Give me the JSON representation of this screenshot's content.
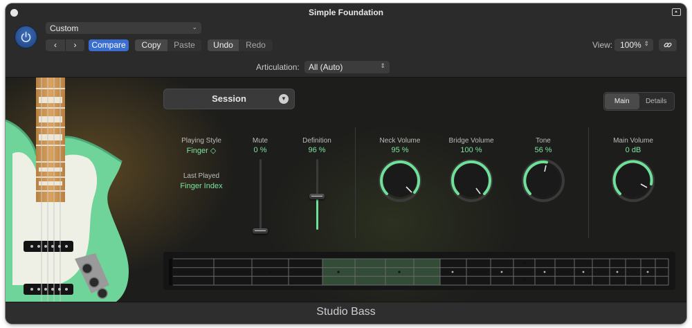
{
  "window": {
    "title": "Simple Foundation"
  },
  "header": {
    "preset": "Custom",
    "back_icon": "‹",
    "forward_icon": "›",
    "compare": "Compare",
    "copy": "Copy",
    "paste": "Paste",
    "undo": "Undo",
    "redo": "Redo",
    "view_label": "View:",
    "zoom": "100%",
    "articulation_label": "Articulation:",
    "articulation_value": "All (Auto)"
  },
  "session": {
    "label": "Session"
  },
  "tabs": [
    {
      "label": "Main",
      "active": true
    },
    {
      "label": "Details",
      "active": false
    }
  ],
  "controls": {
    "playing_style": {
      "label": "Playing Style",
      "value": "Finger ◇"
    },
    "last_played": {
      "label": "Last Played",
      "value": "Finger Index"
    },
    "mute": {
      "label": "Mute",
      "value": "0 %",
      "level": 0
    },
    "definition": {
      "label": "Definition",
      "value": "96 %",
      "level": 0.96
    },
    "neck_volume": {
      "label": "Neck Volume",
      "value": "95 %",
      "level": 0.95
    },
    "bridge_volume": {
      "label": "Bridge Volume",
      "value": "100 %",
      "level": 1.0
    },
    "tone": {
      "label": "Tone",
      "value": "56 %",
      "level": 0.56
    },
    "main_volume": {
      "label": "Main Volume",
      "value": "0 dB",
      "level": 0.8
    }
  },
  "colors": {
    "accent_green": "#6fe09a",
    "compare_blue": "#3a6fd1",
    "power_blue": "#2a5aa8"
  },
  "footer": {
    "instrument_name": "Studio Bass"
  }
}
